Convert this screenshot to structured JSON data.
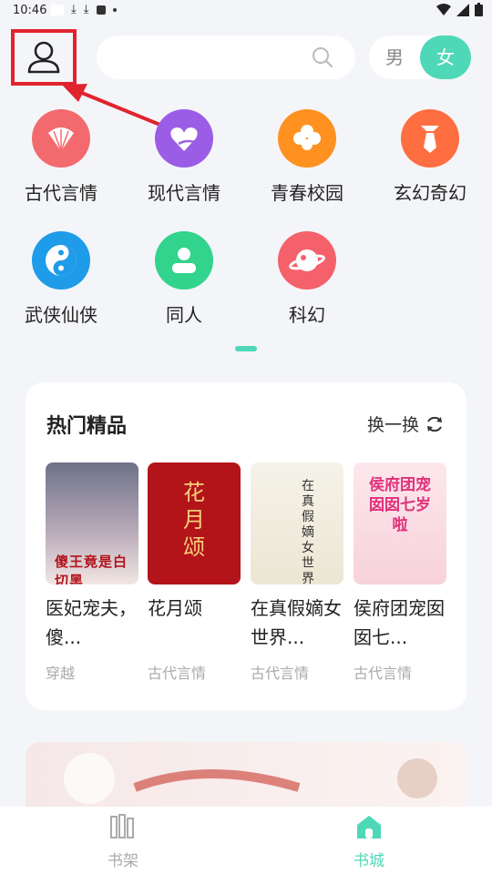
{
  "status": {
    "time": "10:46"
  },
  "header": {
    "male_label": "男",
    "female_label": "女"
  },
  "categories": [
    {
      "label": "古代言情",
      "color": "#f36a6e",
      "icon": "fan-icon"
    },
    {
      "label": "现代言情",
      "color": "#9b5de5",
      "icon": "heart-icon"
    },
    {
      "label": "青春校园",
      "color": "#ff9120",
      "icon": "clover-icon"
    },
    {
      "label": "玄幻奇幻",
      "color": "#ff6e40",
      "icon": "tie-icon"
    },
    {
      "label": "武侠仙侠",
      "color": "#1e9be9",
      "icon": "yinyang-icon"
    },
    {
      "label": "同人",
      "color": "#32d38c",
      "icon": "person-icon"
    },
    {
      "label": "科幻",
      "color": "#f4616b",
      "icon": "planet-icon"
    }
  ],
  "hot": {
    "title": "热门精品",
    "refresh_label": "换一换",
    "books": [
      {
        "title": "医妃宠夫，傻...",
        "tag": "穿越",
        "cover_text": "傻王竟是白切黑"
      },
      {
        "title": "花月颂",
        "tag": "古代言情",
        "cover_text": "花月颂"
      },
      {
        "title": "在真假嫡女世界...",
        "tag": "古代言情",
        "cover_text": "在真假嫡女世界当咸鱼"
      },
      {
        "title": "侯府团宠囡囡七...",
        "tag": "古代言情",
        "cover_text": "侯府团宠囡囡七岁啦"
      }
    ]
  },
  "tabs": {
    "shelf": "书架",
    "store": "书城"
  },
  "colors": {
    "accent": "#4fd8b7",
    "highlight_red": "#e1232e"
  }
}
